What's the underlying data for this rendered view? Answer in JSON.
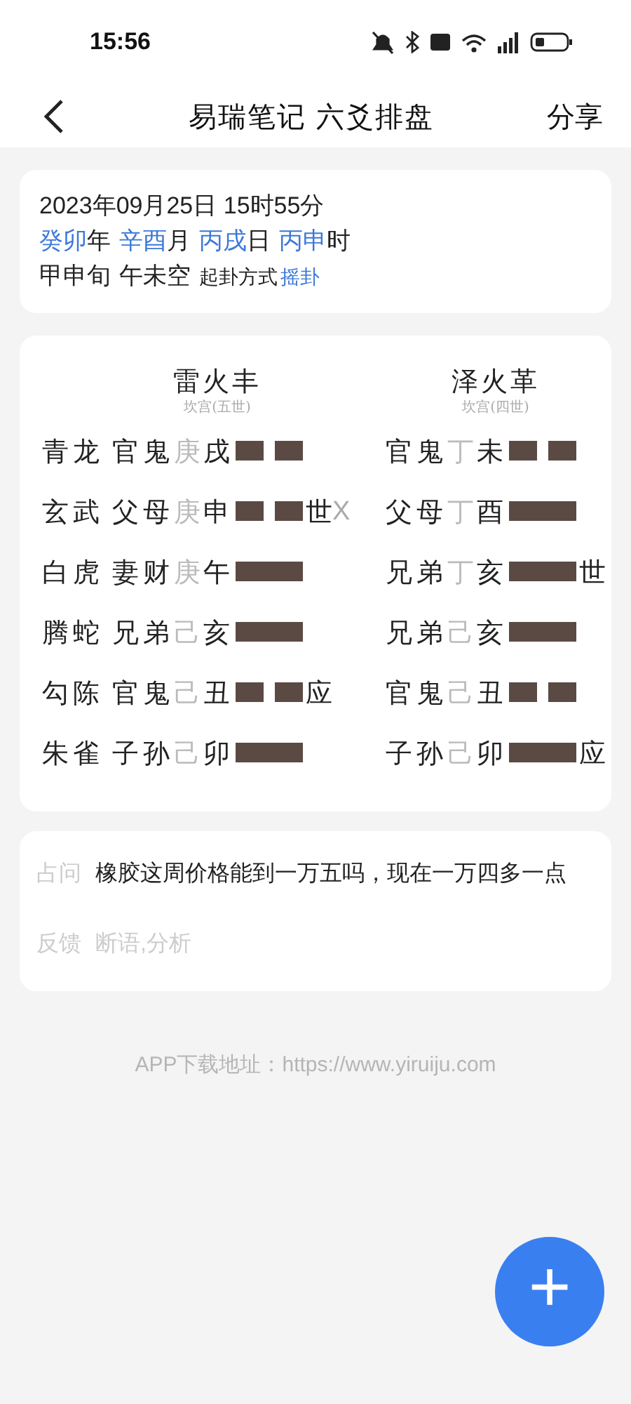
{
  "status_bar": {
    "time": "15:56"
  },
  "header": {
    "title": "易瑞笔记 六爻排盘",
    "action": "分享"
  },
  "date_card": {
    "datetime": "2023年09月25日 15时55分",
    "pillars": [
      {
        "value": "癸卯",
        "unit": "年"
      },
      {
        "value": "辛酉",
        "unit": "月"
      },
      {
        "value": "丙戌",
        "unit": "日"
      },
      {
        "value": "丙申",
        "unit": "时"
      }
    ],
    "xun": "甲申旬",
    "kong": "午未空",
    "method_label": "起卦方式",
    "method": "摇卦"
  },
  "hexagrams": [
    {
      "name": "雷火丰",
      "palace": "坎宫(五世)",
      "lines": [
        {
          "god": "青龙",
          "relation": "官鬼",
          "stem": "庚",
          "branch": "戌",
          "kind": "yin"
        },
        {
          "god": "玄武",
          "relation": "父母",
          "stem": "庚",
          "branch": "申",
          "kind": "yin",
          "marker": "世",
          "moving": "X"
        },
        {
          "god": "白虎",
          "relation": "妻财",
          "stem": "庚",
          "branch": "午",
          "kind": "yang"
        },
        {
          "god": "腾蛇",
          "relation": "兄弟",
          "stem": "己",
          "branch": "亥",
          "kind": "yang"
        },
        {
          "god": "勾陈",
          "relation": "官鬼",
          "stem": "己",
          "branch": "丑",
          "kind": "yin",
          "marker": "应"
        },
        {
          "god": "朱雀",
          "relation": "子孙",
          "stem": "己",
          "branch": "卯",
          "kind": "yang"
        }
      ]
    },
    {
      "name": "泽火革",
      "palace": "坎宫(四世)",
      "lines": [
        {
          "relation": "官鬼",
          "stem": "丁",
          "branch": "未",
          "kind": "yin"
        },
        {
          "relation": "父母",
          "stem": "丁",
          "branch": "酉",
          "kind": "yang"
        },
        {
          "relation": "兄弟",
          "stem": "丁",
          "branch": "亥",
          "kind": "yang",
          "marker": "世"
        },
        {
          "relation": "兄弟",
          "stem": "己",
          "branch": "亥",
          "kind": "yang"
        },
        {
          "relation": "官鬼",
          "stem": "己",
          "branch": "丑",
          "kind": "yin"
        },
        {
          "relation": "子孙",
          "stem": "己",
          "branch": "卯",
          "kind": "yang",
          "marker": "应"
        }
      ]
    }
  ],
  "question_card": {
    "question_label": "占问",
    "question": "橡胶这周价格能到一万五吗，现在一万四多一点",
    "feedback_label": "反馈",
    "feedback": "断语,分析"
  },
  "footer": "APP下载地址：https://www.yiruiju.com",
  "fab": {
    "label": "+"
  }
}
